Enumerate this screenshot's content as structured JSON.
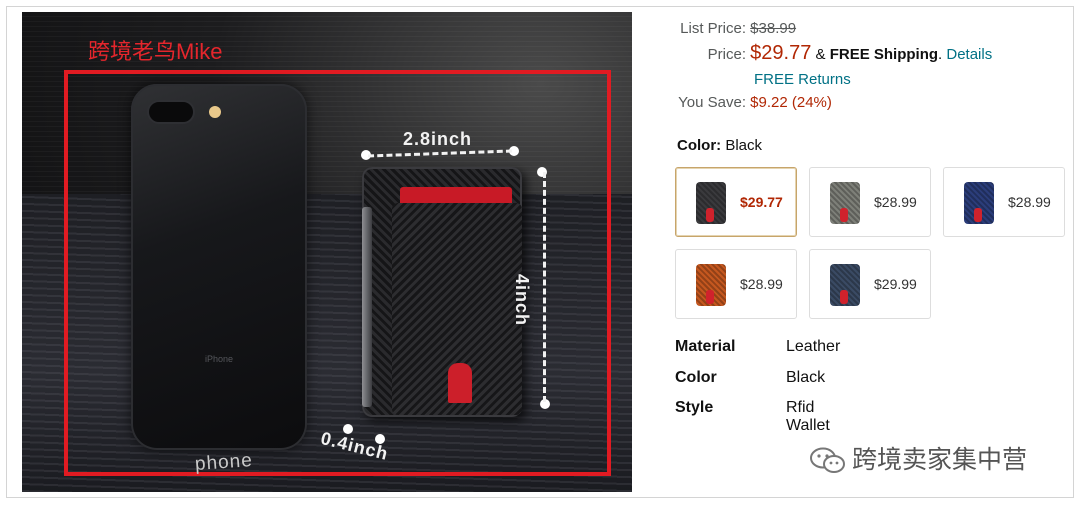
{
  "image": {
    "watermark": "跨境老鸟Mike",
    "phone_brand": "iPhone",
    "phone_label": "phone",
    "dimensions": {
      "width": "2.8inch",
      "height": "4inch",
      "depth": "0.4inch"
    }
  },
  "pricing": {
    "list_price_label": "List Price:",
    "list_price": "$38.99",
    "price_label": "Price:",
    "price": "$29.77",
    "shipping_amp": "&",
    "shipping": "FREE Shipping",
    "shipping_period": ".",
    "details_link": "Details",
    "free_returns": "FREE Returns",
    "you_save_label": "You Save:",
    "you_save": "$9.22 (24%)"
  },
  "color": {
    "label": "Color:",
    "selected": "Black",
    "options": [
      {
        "price": "$29.77",
        "color": "#3a3a3d",
        "selected": true
      },
      {
        "price": "$28.99",
        "color": "#7d7f78"
      },
      {
        "price": "$28.99",
        "color": "#2b3d7a"
      },
      {
        "price": "$28.99",
        "color": "#c4571f"
      },
      {
        "price": "$29.99",
        "color": "#3a4a63"
      }
    ]
  },
  "specs": [
    {
      "key": "Material",
      "value": "Leather"
    },
    {
      "key": "Color",
      "value": "Black"
    },
    {
      "key": "Style",
      "value": "Rfid Wallet"
    }
  ],
  "footer_watermark": "跨境卖家集中营",
  "colors": {
    "accent_red": "#b12704",
    "link": "#007185",
    "frame_red": "#e11b22"
  }
}
